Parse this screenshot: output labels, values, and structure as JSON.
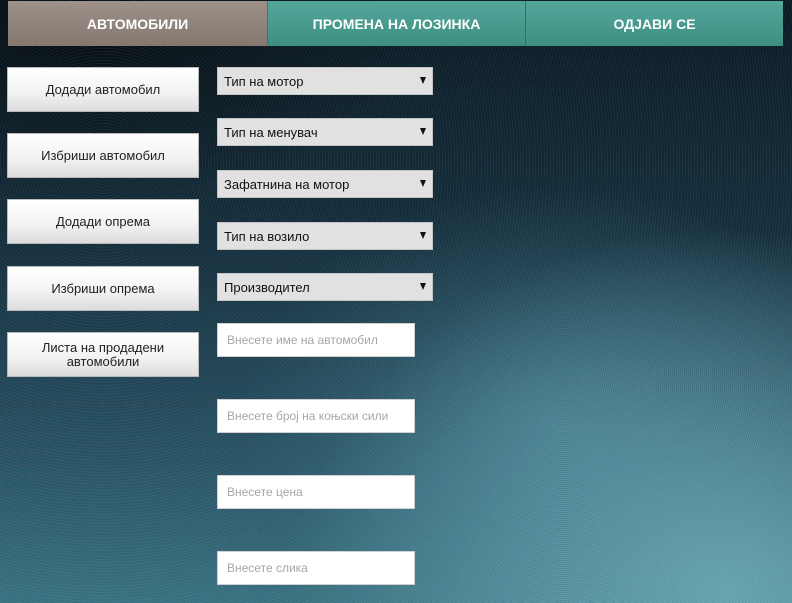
{
  "nav": {
    "tabs": [
      {
        "label": "АВТОМОБИЛИ"
      },
      {
        "label": "ПРОМЕНА НА ЛОЗИНКА"
      },
      {
        "label": "ОДЈАВИ СЕ"
      }
    ],
    "active": "АВТОМОБИЛИ"
  },
  "sidebar": {
    "buttons": [
      {
        "label": "Додади автомобил"
      },
      {
        "label": "Избриши автомобил"
      },
      {
        "label": "Додади опрема"
      },
      {
        "label": "Избриши опрема"
      },
      {
        "label": "Листа на продадени автомобили"
      }
    ]
  },
  "form": {
    "selects": [
      {
        "value": "Тип на мотор"
      },
      {
        "value": "Тип на менувач"
      },
      {
        "value": "Зафатнина на мотор"
      },
      {
        "value": "Тип на возило"
      },
      {
        "value": "Производител"
      }
    ],
    "inputs": [
      {
        "placeholder": "Внесете име на автомобил"
      },
      {
        "placeholder": "Внесете број на коњски сили"
      },
      {
        "placeholder": "Внесете цена"
      },
      {
        "placeholder": "Внесете слика"
      }
    ]
  },
  "colors": {
    "active_tab": "#918379",
    "tab": "#489b8e",
    "background": "#1f4150"
  },
  "icons": {
    "select_caret": "caret-down-icon"
  }
}
